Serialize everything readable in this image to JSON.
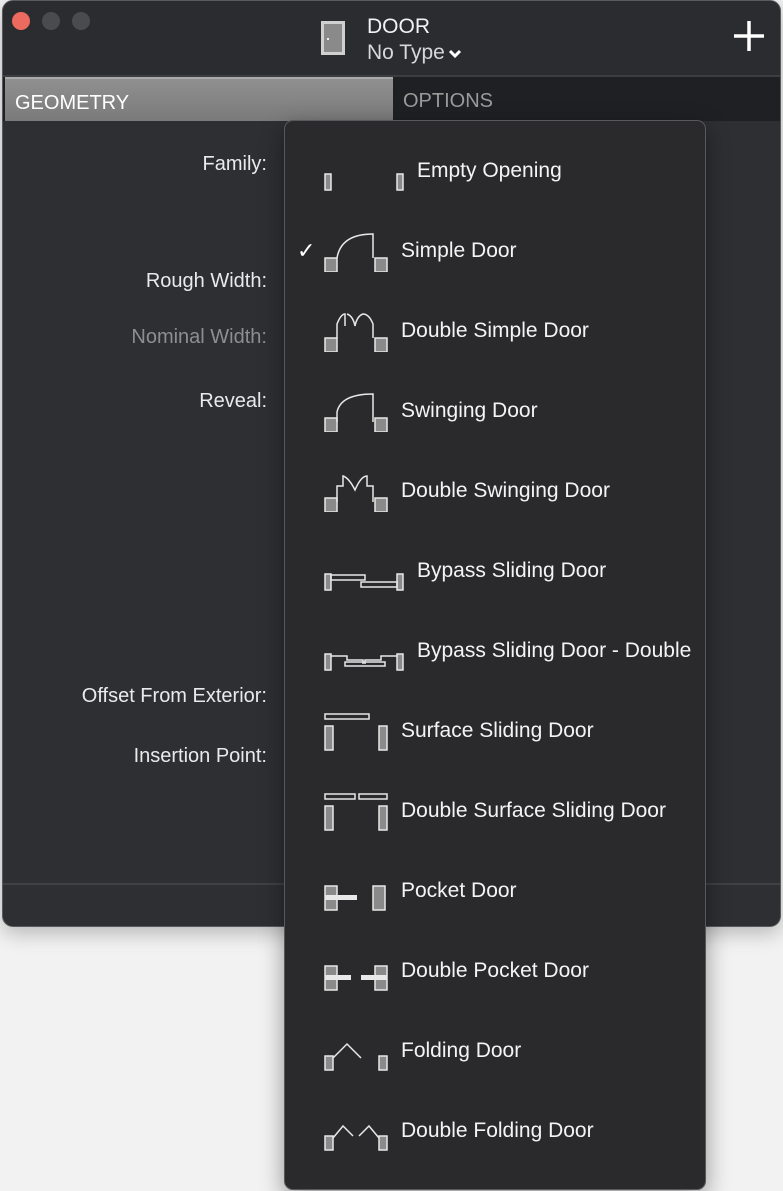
{
  "window": {
    "title": "DOOR",
    "type_selector": "No Type",
    "traffic_lights": {
      "close": "#ed6a5e",
      "minimize": "#4a4b4f",
      "zoom": "#4a4b4f"
    },
    "add_icon": "plus-icon",
    "title_icon": "door-icon"
  },
  "tabs": [
    {
      "label": "GEOMETRY",
      "active": true
    },
    {
      "label": "OPTIONS",
      "active": false
    }
  ],
  "form": {
    "family_label": "Family:",
    "rough_width_label": "Rough Width:",
    "nominal_width_label": "Nominal Width:",
    "reveal_label": "Reveal:",
    "offset_label": "Offset From Exterior:",
    "insertion_label": "Insertion Point:"
  },
  "family_menu": {
    "selected": "Simple Door",
    "items": [
      {
        "label": "Empty Opening",
        "icon": "empty-opening"
      },
      {
        "label": "Simple Door",
        "icon": "simple-door",
        "checked": true
      },
      {
        "label": "Double Simple Door",
        "icon": "double-simple-door"
      },
      {
        "label": "Swinging Door",
        "icon": "swinging-door"
      },
      {
        "label": "Double Swinging Door",
        "icon": "double-swinging-door"
      },
      {
        "label": "Bypass Sliding Door",
        "icon": "bypass-sliding-door"
      },
      {
        "label": "Bypass Sliding Door - Double",
        "icon": "bypass-sliding-door-double"
      },
      {
        "label": "Surface Sliding Door",
        "icon": "surface-sliding-door"
      },
      {
        "label": "Double Surface Sliding Door",
        "icon": "double-surface-sliding-door"
      },
      {
        "label": "Pocket Door",
        "icon": "pocket-door"
      },
      {
        "label": "Double Pocket Door",
        "icon": "double-pocket-door"
      },
      {
        "label": "Folding Door",
        "icon": "folding-door"
      },
      {
        "label": "Double Folding Door",
        "icon": "double-folding-door"
      }
    ]
  }
}
